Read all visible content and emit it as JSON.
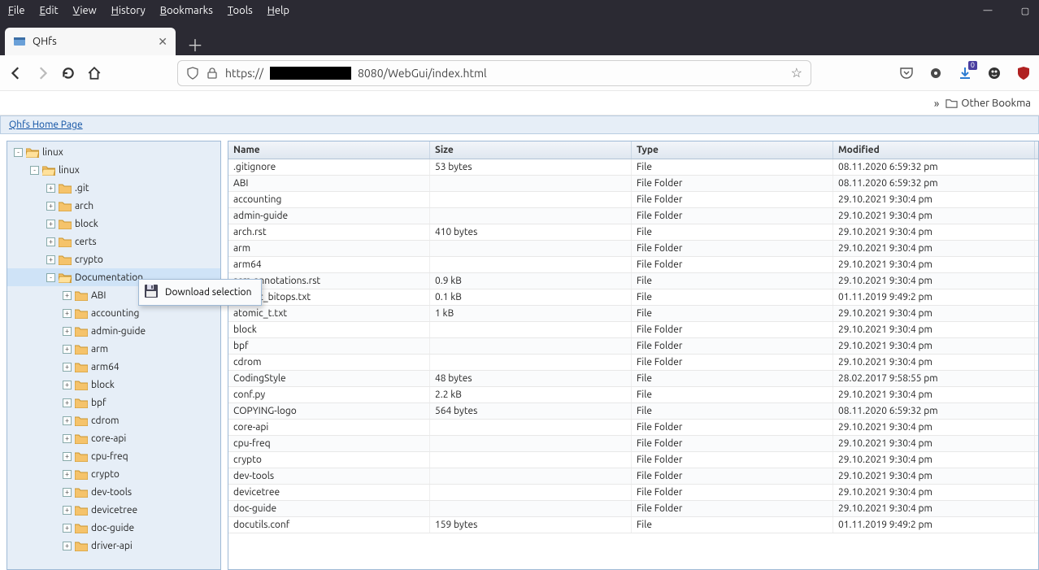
{
  "menubar": {
    "items": [
      "File",
      "Edit",
      "View",
      "History",
      "Bookmarks",
      "Tools",
      "Help"
    ]
  },
  "tab": {
    "title": "QHfs"
  },
  "url": {
    "prefix": "https://",
    "suffix": "8080/WebGui/index.html"
  },
  "bookbar": {
    "other": "Other Bookma"
  },
  "breadcrumb": {
    "label": "Qhfs Home Page"
  },
  "context_menu": {
    "download": "Download selection"
  },
  "tree": [
    {
      "d": 0,
      "exp": "-",
      "open": true,
      "label": "linux"
    },
    {
      "d": 1,
      "exp": "-",
      "open": true,
      "label": "linux"
    },
    {
      "d": 2,
      "exp": "+",
      "open": false,
      "label": ".git"
    },
    {
      "d": 2,
      "exp": "+",
      "open": false,
      "label": "arch"
    },
    {
      "d": 2,
      "exp": "+",
      "open": false,
      "label": "block"
    },
    {
      "d": 2,
      "exp": "+",
      "open": false,
      "label": "certs"
    },
    {
      "d": 2,
      "exp": "+",
      "open": false,
      "label": "crypto"
    },
    {
      "d": 2,
      "exp": "-",
      "open": true,
      "label": "Documentation",
      "selected": true
    },
    {
      "d": 3,
      "exp": "+",
      "open": false,
      "label": "ABI"
    },
    {
      "d": 3,
      "exp": "+",
      "open": false,
      "label": "accounting"
    },
    {
      "d": 3,
      "exp": "+",
      "open": false,
      "label": "admin-guide"
    },
    {
      "d": 3,
      "exp": "+",
      "open": false,
      "label": "arm"
    },
    {
      "d": 3,
      "exp": "+",
      "open": false,
      "label": "arm64"
    },
    {
      "d": 3,
      "exp": "+",
      "open": false,
      "label": "block"
    },
    {
      "d": 3,
      "exp": "+",
      "open": false,
      "label": "bpf"
    },
    {
      "d": 3,
      "exp": "+",
      "open": false,
      "label": "cdrom"
    },
    {
      "d": 3,
      "exp": "+",
      "open": false,
      "label": "core-api"
    },
    {
      "d": 3,
      "exp": "+",
      "open": false,
      "label": "cpu-freq"
    },
    {
      "d": 3,
      "exp": "+",
      "open": false,
      "label": "crypto"
    },
    {
      "d": 3,
      "exp": "+",
      "open": false,
      "label": "dev-tools"
    },
    {
      "d": 3,
      "exp": "+",
      "open": false,
      "label": "devicetree"
    },
    {
      "d": 3,
      "exp": "+",
      "open": false,
      "label": "doc-guide"
    },
    {
      "d": 3,
      "exp": "+",
      "open": false,
      "label": "driver-api"
    }
  ],
  "grid": {
    "headers": [
      "Name",
      "Size",
      "Type",
      "Modified"
    ],
    "rows": [
      {
        "name": ".gitignore",
        "size": "53 bytes",
        "type": "File",
        "modified": "08.11.2020 6:59:32 pm"
      },
      {
        "name": "ABI",
        "size": "",
        "type": "File Folder",
        "modified": "08.11.2020 6:59:32 pm"
      },
      {
        "name": "accounting",
        "size": "",
        "type": "File Folder",
        "modified": "29.10.2021 9:30:4 pm"
      },
      {
        "name": "admin-guide",
        "size": "",
        "type": "File Folder",
        "modified": "29.10.2021 9:30:4 pm"
      },
      {
        "name": "arch.rst",
        "size": "410 bytes",
        "type": "File",
        "modified": "29.10.2021 9:30:4 pm"
      },
      {
        "name": "arm",
        "size": "",
        "type": "File Folder",
        "modified": "29.10.2021 9:30:4 pm"
      },
      {
        "name": "arm64",
        "size": "",
        "type": "File Folder",
        "modified": "29.10.2021 9:30:4 pm"
      },
      {
        "name": "asm-annotations.rst",
        "size": "0.9 kB",
        "type": "File",
        "modified": "29.10.2021 9:30:4 pm"
      },
      {
        "name": "atomic_bitops.txt",
        "size": "0.1 kB",
        "type": "File",
        "modified": "01.11.2019 9:49:2 pm"
      },
      {
        "name": "atomic_t.txt",
        "size": "1 kB",
        "type": "File",
        "modified": "29.10.2021 9:30:4 pm"
      },
      {
        "name": "block",
        "size": "",
        "type": "File Folder",
        "modified": "29.10.2021 9:30:4 pm"
      },
      {
        "name": "bpf",
        "size": "",
        "type": "File Folder",
        "modified": "29.10.2021 9:30:4 pm"
      },
      {
        "name": "cdrom",
        "size": "",
        "type": "File Folder",
        "modified": "29.10.2021 9:30:4 pm"
      },
      {
        "name": "CodingStyle",
        "size": "48 bytes",
        "type": "File",
        "modified": "28.02.2017 9:58:55 pm"
      },
      {
        "name": "conf.py",
        "size": "2.2 kB",
        "type": "File",
        "modified": "29.10.2021 9:30:4 pm"
      },
      {
        "name": "COPYING-logo",
        "size": "564 bytes",
        "type": "File",
        "modified": "08.11.2020 6:59:32 pm"
      },
      {
        "name": "core-api",
        "size": "",
        "type": "File Folder",
        "modified": "29.10.2021 9:30:4 pm"
      },
      {
        "name": "cpu-freq",
        "size": "",
        "type": "File Folder",
        "modified": "29.10.2021 9:30:4 pm"
      },
      {
        "name": "crypto",
        "size": "",
        "type": "File Folder",
        "modified": "29.10.2021 9:30:4 pm"
      },
      {
        "name": "dev-tools",
        "size": "",
        "type": "File Folder",
        "modified": "29.10.2021 9:30:4 pm"
      },
      {
        "name": "devicetree",
        "size": "",
        "type": "File Folder",
        "modified": "29.10.2021 9:30:4 pm"
      },
      {
        "name": "doc-guide",
        "size": "",
        "type": "File Folder",
        "modified": "29.10.2021 9:30:4 pm"
      },
      {
        "name": "docutils.conf",
        "size": "159 bytes",
        "type": "File",
        "modified": "01.11.2019 9:49:2 pm"
      }
    ]
  }
}
